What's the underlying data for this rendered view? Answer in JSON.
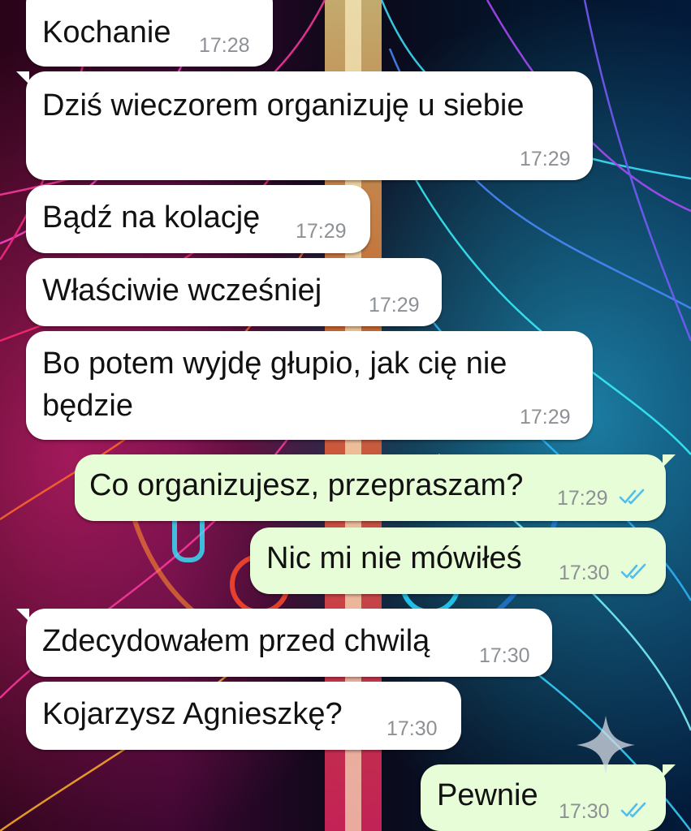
{
  "colors": {
    "incoming_bubble": "#ffffff",
    "outgoing_bubble": "#e7fdd7",
    "text": "#111111",
    "timestamp": "#8d9196",
    "read_ticks": "#53bdeb"
  },
  "icons": {
    "read_receipt": "double-check-icon",
    "watermark": "sparkle-icon"
  },
  "messages": [
    {
      "direction": "incoming",
      "text": "Kochanie",
      "time": "17:28"
    },
    {
      "direction": "incoming",
      "text": "Dziś wieczorem organizuję u siebie",
      "time": "17:29"
    },
    {
      "direction": "incoming",
      "text": "Bądź na kolację",
      "time": "17:29"
    },
    {
      "direction": "incoming",
      "text": "Właściwie wcześniej",
      "time": "17:29"
    },
    {
      "direction": "incoming",
      "text": "Bo potem wyjdę głupio, jak cię nie będzie",
      "time": "17:29"
    },
    {
      "direction": "outgoing",
      "text": "Co organizujesz, przepraszam?",
      "time": "17:29",
      "status": "read"
    },
    {
      "direction": "outgoing",
      "text": "Nic mi nie mówiłeś",
      "time": "17:30",
      "status": "read"
    },
    {
      "direction": "incoming",
      "text": "Zdecydowałem przed chwilą",
      "time": "17:30"
    },
    {
      "direction": "incoming",
      "text": "Kojarzysz Agnieszkę?",
      "time": "17:30"
    },
    {
      "direction": "outgoing",
      "text": "Pewnie",
      "time": "17:30",
      "status": "read"
    }
  ]
}
